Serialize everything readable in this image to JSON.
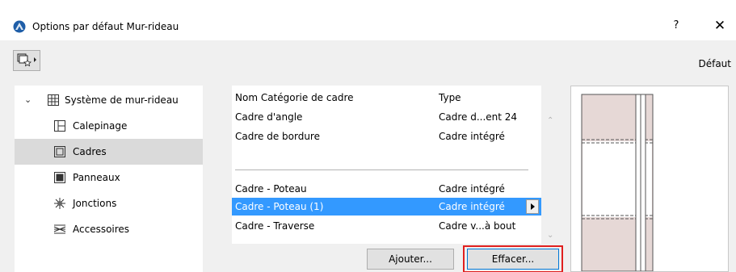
{
  "window": {
    "title": "Options par défaut Mur-rideau",
    "help_label": "?",
    "close_label": "✕"
  },
  "toolbar": {
    "favorites_icon": "favorites-star-icon",
    "default_label": "Défaut"
  },
  "nav": {
    "root": {
      "label": "Système de mur-rideau",
      "icon": "curtain-wall-system-icon",
      "expanded": true
    },
    "items": [
      {
        "label": "Calepinage",
        "icon": "scheme-grid-icon",
        "selected": false
      },
      {
        "label": "Cadres",
        "icon": "frame-icon",
        "selected": true
      },
      {
        "label": "Panneaux",
        "icon": "panel-icon",
        "selected": false
      },
      {
        "label": "Jonctions",
        "icon": "junction-icon",
        "selected": false
      },
      {
        "label": "Accessoires",
        "icon": "accessory-icon",
        "selected": false
      }
    ]
  },
  "frames_table": {
    "headers": [
      "Nom Catégorie de cadre",
      "Type"
    ],
    "rows": [
      {
        "name": "Cadre d'angle",
        "type": "Cadre d...ent 24",
        "selected": false
      },
      {
        "name": "Cadre de bordure",
        "type": "Cadre intégré",
        "selected": false
      },
      {
        "name": "Cadre - Poteau",
        "type": "Cadre intégré",
        "selected": false
      },
      {
        "name": "Cadre - Poteau (1)",
        "type": "Cadre intégré",
        "selected": true
      },
      {
        "name": "Cadre - Traverse",
        "type": "Cadre v...à bout",
        "selected": false
      }
    ]
  },
  "buttons": {
    "add_label": "Ajouter...",
    "delete_label": "Effacer..."
  },
  "colors": {
    "selection": "#3399ff",
    "highlight_border": "#e0201f",
    "preview_panel_fill": "#e6d8d6",
    "preview_glass_fill": "#ffffff"
  }
}
